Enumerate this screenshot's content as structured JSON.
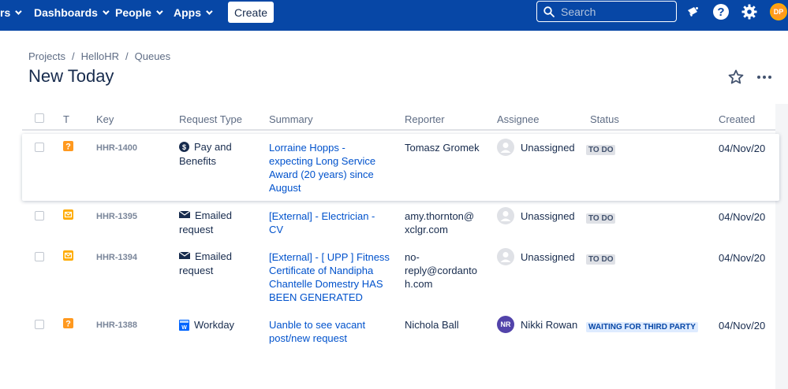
{
  "nav": {
    "partial_item": "rs",
    "dashboards": "Dashboards",
    "people": "People",
    "apps": "Apps",
    "create": "Create",
    "search_placeholder": "Search",
    "user_initials": "DP"
  },
  "breadcrumb": {
    "projects": "Projects",
    "project": "HelloHR",
    "queues": "Queues",
    "sep": "/"
  },
  "page": {
    "title": "New Today"
  },
  "columns": {
    "t": "T",
    "key": "Key",
    "request_type": "Request Type",
    "summary": "Summary",
    "reporter": "Reporter",
    "assignee": "Assignee",
    "status": "Status",
    "created": "Created"
  },
  "rows": [
    {
      "key": "HHR-1400",
      "type_line1": "Pay and",
      "type_line2": "Benefits",
      "summary_lines": [
        "Lorraine Hopps -",
        "expecting Long Service",
        "Award (20 years) since",
        "August"
      ],
      "reporter_lines": [
        "Tomasz Gromek"
      ],
      "assignee": "Unassigned",
      "status": "TO DO",
      "created": "04/Nov/20",
      "icon": "question-icon",
      "type_icon": "dollar-icon"
    },
    {
      "key": "HHR-1395",
      "type_line1": "Emailed",
      "type_line2": "request",
      "summary_lines": [
        "[External] - Electrician -",
        "CV"
      ],
      "reporter_lines": [
        "amy.thornton@",
        "xclgr.com"
      ],
      "assignee": "Unassigned",
      "status": "TO DO",
      "created": "04/Nov/20",
      "icon": "email-icon",
      "type_icon": "envelope-icon"
    },
    {
      "key": "HHR-1394",
      "type_line1": "Emailed",
      "type_line2": "request",
      "summary_lines": [
        "[External] - [ UPP ] Fitness",
        "Certificate of Nandipha",
        "Chantelle Domestry HAS",
        "BEEN GENERATED"
      ],
      "reporter_lines": [
        "no-",
        "reply@cordanto",
        "h.com"
      ],
      "assignee": "Unassigned",
      "status": "TO DO",
      "created": "04/Nov/20",
      "icon": "email-icon",
      "type_icon": "envelope-icon"
    },
    {
      "key": "HHR-1388",
      "type_line1": "Workday",
      "type_line2": "",
      "summary_lines": [
        "Uanble to see vacant",
        "post/new request"
      ],
      "reporter_lines": [
        "Nichola Ball"
      ],
      "assignee": "Nikki Rowan",
      "assignee_initials": "NR",
      "status": "WAITING FOR THIRD PARTY",
      "created": "04/Nov/20",
      "icon": "question-icon",
      "type_icon": "workday-icon"
    }
  ],
  "colors": {
    "nav_bg": "#0747a6",
    "link": "#0052cc",
    "question_icon": "#ff991f",
    "email_icon": "#ffab00",
    "workday_icon": "#0065ff"
  }
}
